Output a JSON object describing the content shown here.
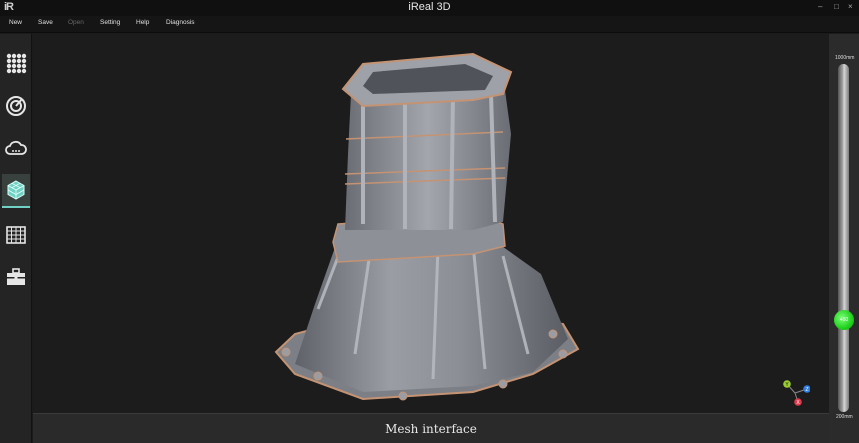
{
  "app": {
    "logo_text": "iR",
    "title": "iReal 3D"
  },
  "window_controls": {
    "minimize": "–",
    "maximize": "□",
    "close": "×"
  },
  "menu": {
    "new": "New",
    "save": "Save",
    "open": "Open",
    "setting": "Setting",
    "help": "Help",
    "diagnosis": "Diagnosis"
  },
  "sidebar": {
    "items": [
      {
        "icon": "grid-dots-icon",
        "active": false
      },
      {
        "icon": "scan-dial-icon",
        "active": false
      },
      {
        "icon": "cloud-icon",
        "active": false
      },
      {
        "icon": "mesh-cube-icon",
        "active": true
      },
      {
        "icon": "grid-table-icon",
        "active": false
      },
      {
        "icon": "toolbox-icon",
        "active": false
      }
    ]
  },
  "gizmo": {
    "y_label": "Y",
    "z_label": "Z",
    "x_label": "X",
    "y_color": "#9acd32",
    "z_color": "#2f7fe0",
    "x_color": "#e0394b"
  },
  "slider": {
    "max_label": "1000mm",
    "min_label": "200mm",
    "value_label": "450",
    "value": 450,
    "knob_color": "#22dd1f"
  },
  "status": {
    "text": "Mesh interface"
  },
  "colors": {
    "accent": "#6fd2c4",
    "model_body": "#8a8d94",
    "model_edge": "#c49373"
  }
}
